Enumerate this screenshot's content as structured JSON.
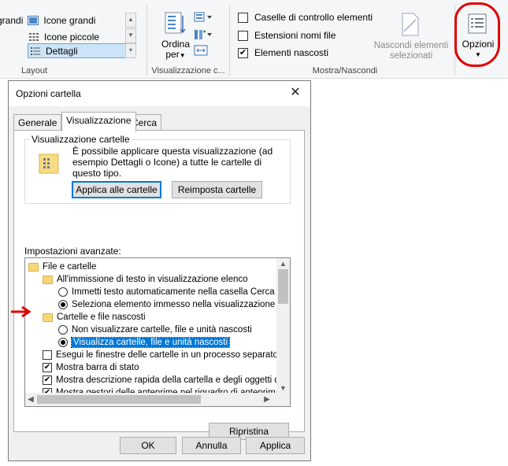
{
  "ribbon": {
    "layout": {
      "items": [
        {
          "label": "grandi",
          "icon": "large-icons-icon"
        },
        {
          "label": "Icone grandi",
          "icon": "large-icons-icon"
        },
        {
          "label": "Icone piccole",
          "icon": "small-icons-icon"
        },
        {
          "label": "Dettagli",
          "icon": "details-icon",
          "selected": true
        }
      ],
      "group_label": "Layout"
    },
    "current_view": {
      "sort_label_line1": "Ordina",
      "sort_label_line2": "per",
      "group_label": "Visualizzazione c..."
    },
    "show_hide": {
      "checkboxes": [
        {
          "label": "Caselle di controllo elementi",
          "checked": false
        },
        {
          "label": "Estensioni nomi file",
          "checked": false
        },
        {
          "label": "Elementi nascosti",
          "checked": true
        }
      ],
      "hide_selected_line1": "Nascondi elementi",
      "hide_selected_line2": "selezionati",
      "group_label": "Mostra/Nascondi"
    },
    "options_label": "Opzioni",
    "annotation_color": "#e00000"
  },
  "dialog": {
    "title": "Opzioni cartella",
    "close_glyph": "✕",
    "tabs": [
      "Generale",
      "Visualizzazione",
      "Cerca"
    ],
    "active_tab": "Visualizzazione",
    "folder_views": {
      "legend": "Visualizzazione cartelle",
      "description": "È possibile applicare questa visualizzazione (ad esempio Dettagli o Icone) a tutte le cartelle di questo tipo.",
      "apply_button": "Applica alle cartelle",
      "reset_button": "Reimposta cartelle"
    },
    "advanced": {
      "label": "Impostazioni avanzate:",
      "rows": [
        {
          "type": "folder",
          "text": "File e cartelle",
          "indent": 0
        },
        {
          "type": "folder",
          "text": "All'immissione di testo in visualizzazione elenco",
          "indent": 1
        },
        {
          "type": "radio",
          "text": "Immetti testo automaticamente nella casella Cerca",
          "checked": false,
          "indent": 2
        },
        {
          "type": "radio",
          "text": "Seleziona elemento immesso nella visualizzazione",
          "checked": true,
          "indent": 2
        },
        {
          "type": "folder",
          "text": "Cartelle e file nascosti",
          "indent": 1
        },
        {
          "type": "radio",
          "text": "Non visualizzare cartelle, file e unità nascosti",
          "checked": false,
          "indent": 2
        },
        {
          "type": "radio",
          "text": "Visualizza cartelle, file e unità nascosti",
          "checked": true,
          "indent": 2,
          "highlighted": true
        },
        {
          "type": "checkbox",
          "text": "Esegui le finestre delle cartelle in un processo separato",
          "checked": false,
          "indent": 1
        },
        {
          "type": "checkbox",
          "text": "Mostra barra di stato",
          "checked": true,
          "indent": 1
        },
        {
          "type": "checkbox",
          "text": "Mostra descrizione rapida della cartella e degli oggetti del",
          "checked": true,
          "indent": 1
        },
        {
          "type": "checkbox",
          "text": "Mostra gestori delle anteprime nel riquadro di anteprima",
          "checked": true,
          "indent": 1
        }
      ]
    },
    "restore_button": "Ripristina",
    "ok_button": "OK",
    "cancel_button": "Annulla",
    "apply_button": "Applica",
    "accent_color": "#0078d7"
  }
}
